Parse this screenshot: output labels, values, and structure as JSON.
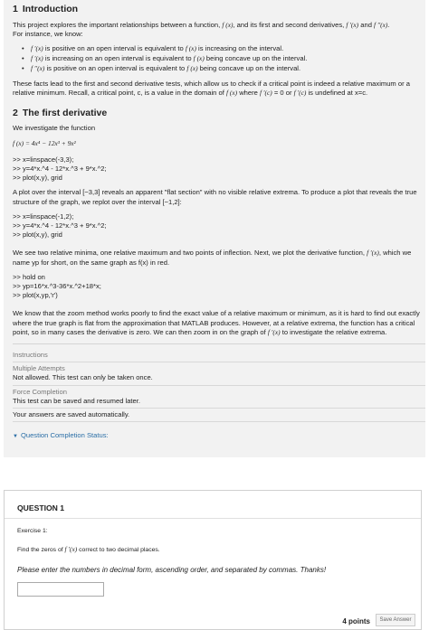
{
  "intro": {
    "number": "1",
    "title": "Introduction",
    "p1_a": "This project explores the important relationships between a function,",
    "p1_fx": "f (x)",
    "p1_b": ", and its first and second derivatives,",
    "p1_f1": "f ′(x)",
    "p1_and": "and",
    "p1_f2": "f ′′(x)",
    "p1_c": ".",
    "p1_d": "For instance, we know:",
    "facts": [
      {
        "math": "f ′(x)",
        "a": "is positive on an open interval is equivalent to",
        "math2": "f (x)",
        "b": "is increasing on the interval."
      },
      {
        "math": "f ′(x)",
        "a": "is increasing on an open interval is equivalent to",
        "math2": "f (x)",
        "b": "being concave up on the interval."
      },
      {
        "math": "f ′′(x)",
        "a": "is positive on an open interval is equivalent to",
        "math2": "f (x)",
        "b": "being concave up on the interval."
      }
    ],
    "p2_a": "These facts lead to the first and second derivative tests, which allow us to check if a critical point is indeed a relative maximum or a relative minimum. Recall, a critical point, c, is a value in the domain of",
    "p2_fx": "f (x)",
    "p2_b": "where",
    "p2_fc": "f ′(c)",
    "p2_c": "= 0 or",
    "p2_fc2": "f ′(c)",
    "p2_d": "is undefined at x=c."
  },
  "section2": {
    "number": "2",
    "title": "The first derivative",
    "investigate": "We investigate the function",
    "function": "f (x) = 4x⁴ − 12x³ + 9x²",
    "code1": [
      ">> x=linspace(-3,3);",
      ">> y=4*x.^4 - 12*x.^3 + 9*x.^2;",
      ">> plot(x,y), grid"
    ],
    "p_plot": "A plot over the interval [−3,3] reveals an apparent \"flat section\" with no visible relative extrema. To produce a plot that reveals the true structure of the graph, we replot over the interval [−1,2]:",
    "code2": [
      ">> x=linspace(-1,2);",
      ">> y=4*x.^4 - 12*x.^3 + 9*x.^2;",
      ">> plot(x,y), grid"
    ],
    "p_see_a": "We see two relative minima, one relative maximum and two points of inflection. Next, we plot the derivative function,",
    "p_see_f": "f ′(x)",
    "p_see_b": ", which we name yp for short, on the same graph as f(x) in red.",
    "code3": [
      ">> hold on",
      ">> yp=16*x.^3-36*x.^2+18*x;",
      ">> plot(x,yp,'r')"
    ],
    "p_zoom_a": "We know that the zoom method works poorly to find the exact value of a relative maximum or minimum, as it is hard to find out exactly where the true graph is flat from the approximation that MATLAB produces. However, at a relative extrema, the function has a critical point, so in many cases the derivative is zero. We can then zoom in on the graph of",
    "p_zoom_f": "f ′(x)",
    "p_zoom_b": "to investigate the relative extrema."
  },
  "instructions": {
    "heading": "Instructions",
    "multiple_label": "Multiple Attempts",
    "multiple_value": "Not allowed. This test can only be taken once.",
    "force_label": "Force Completion",
    "force_value": "This test can be saved and resumed later.",
    "autosave": "Your answers are saved automatically."
  },
  "status": {
    "label": "Question Completion Status:"
  },
  "question": {
    "title": "QUESTION 1",
    "exercise": "Exercise 1:",
    "find_a": "Find the zeros of",
    "find_f": "f ′(x)",
    "find_b": "correct to two decimal places.",
    "please": "Please enter the numbers in decimal form, ascending order, and separated by commas. Thanks!",
    "answer_value": "",
    "points": "4 points",
    "save_label": "Save Answer"
  },
  "colors": {
    "panel_bg": "#f2f2f2",
    "link": "#2a6ea6"
  }
}
